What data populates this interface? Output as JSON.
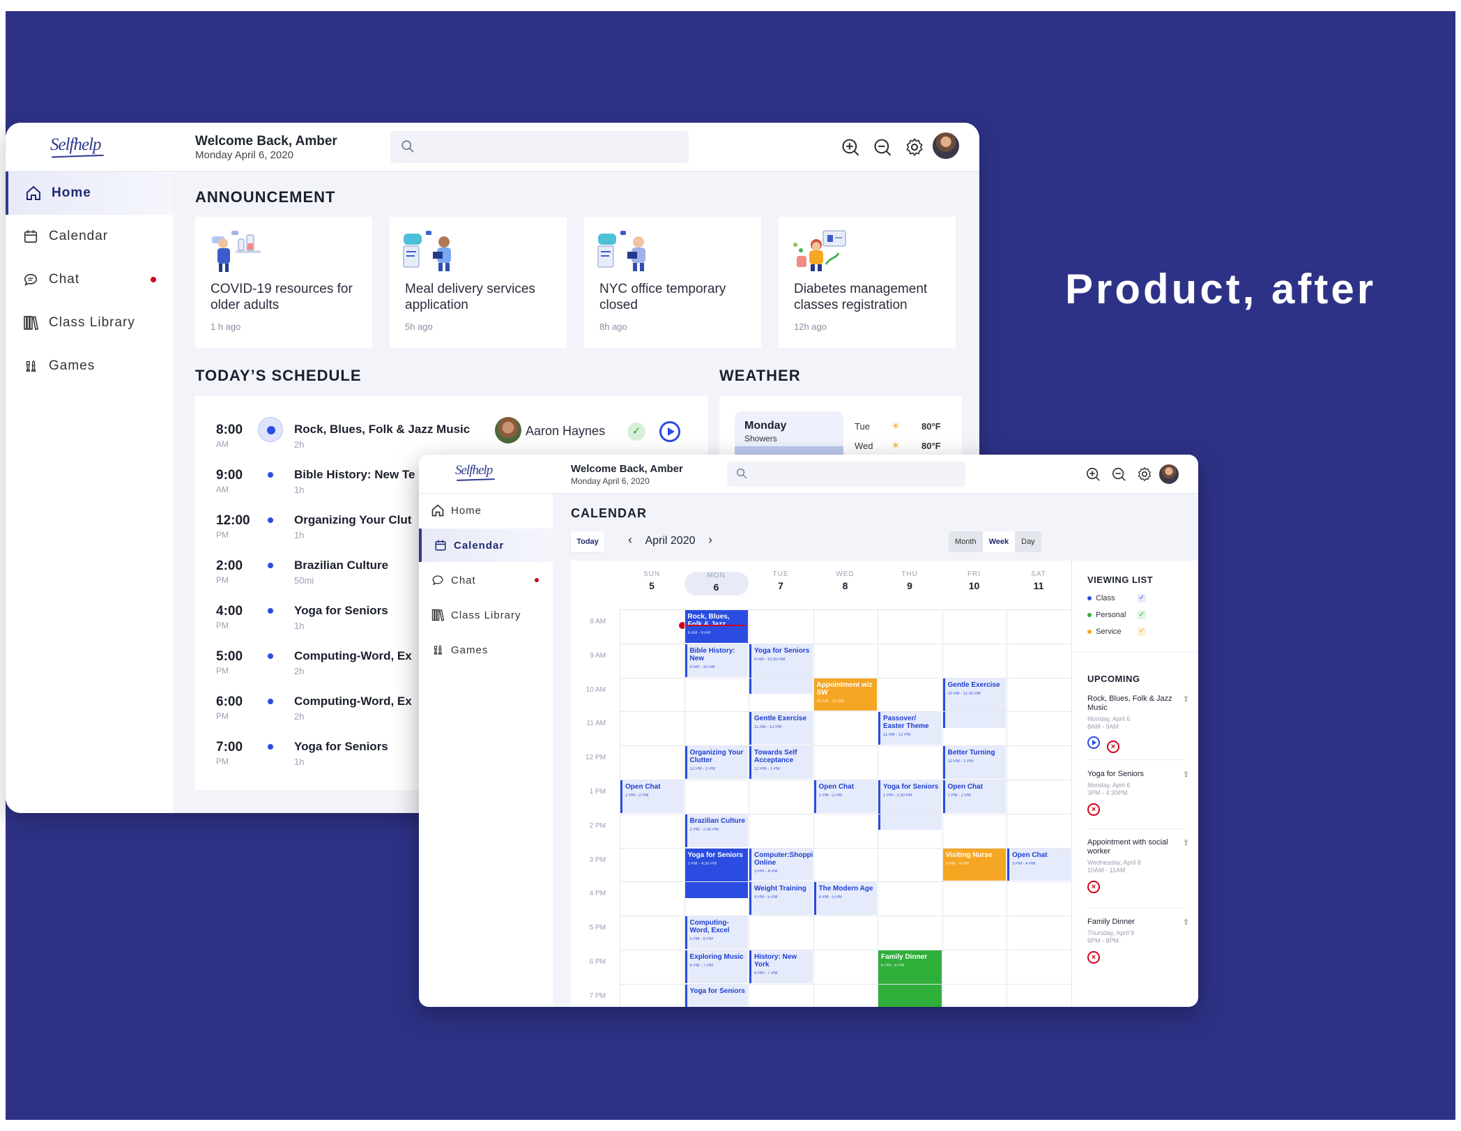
{
  "label": "Product, after",
  "colors": {
    "background": "#2e3287",
    "accent": "#2a4ce0",
    "class": "#2a4ce0",
    "personal": "#2fae3a",
    "service": "#f5a623",
    "alert": "#d0021b"
  },
  "home": {
    "logo": "Selfhelp",
    "welcome": "Welcome Back, Amber",
    "date": "Monday April 6, 2020",
    "toolbar_icons": [
      "zoom-in-icon",
      "zoom-out-icon",
      "gear-icon",
      "avatar"
    ],
    "nav": [
      {
        "label": "Home",
        "icon": "home-icon"
      },
      {
        "label": "Calendar",
        "icon": "calendar-icon"
      },
      {
        "label": "Chat",
        "icon": "chat-icon"
      },
      {
        "label": "Class Library",
        "icon": "library-icon"
      },
      {
        "label": "Games",
        "icon": "chess-icon"
      }
    ],
    "announcement_title": "ANNOUNCEMENT",
    "announcements": [
      {
        "title": "COVID-19 resources for older adults",
        "time": "1 h ago"
      },
      {
        "title": "Meal delivery services application",
        "time": "5h ago"
      },
      {
        "title": "NYC office temporary closed",
        "time": "8h ago"
      },
      {
        "title": "Diabetes management classes registration",
        "time": "12h ago"
      }
    ],
    "schedule_title": "TODAY’S SCHEDULE",
    "schedule": [
      {
        "time": "8:00",
        "ampm": "AM",
        "name": "Rock, Blues, Folk & Jazz Music",
        "dur": "2h",
        "teacher": "Aaron Haynes"
      },
      {
        "time": "9:00",
        "ampm": "AM",
        "name": "Bible History: New Te",
        "dur": "1h"
      },
      {
        "time": "12:00",
        "ampm": "PM",
        "name": "Organizing Your Clut",
        "dur": "1h"
      },
      {
        "time": "2:00",
        "ampm": "PM",
        "name": "Brazilian Culture",
        "dur": "50mi"
      },
      {
        "time": "4:00",
        "ampm": "PM",
        "name": "Yoga for Seniors",
        "dur": "1h"
      },
      {
        "time": "5:00",
        "ampm": "PM",
        "name": "Computing-Word, Ex",
        "dur": "2h"
      },
      {
        "time": "6:00",
        "ampm": "PM",
        "name": "Computing-Word, Ex",
        "dur": "2h"
      },
      {
        "time": "7:00",
        "ampm": "PM",
        "name": "Yoga for Seniors",
        "dur": "1h"
      }
    ],
    "weather_title": "WEATHER",
    "weather": {
      "today": {
        "day": "Monday",
        "cond": "Showers"
      },
      "forecast": [
        {
          "day": "Tue",
          "temp": "80°F",
          "icon": "sun-icon"
        },
        {
          "day": "Wed",
          "temp": "80°F",
          "icon": "sun-icon"
        }
      ]
    }
  },
  "calendar": {
    "logo": "Selfhelp",
    "welcome": "Welcome Back, Amber",
    "date": "Monday April 6, 2020",
    "nav": [
      {
        "label": "Home",
        "icon": "home-icon"
      },
      {
        "label": "Calendar",
        "icon": "calendar-icon"
      },
      {
        "label": "Chat",
        "icon": "chat-icon"
      },
      {
        "label": "Class Library",
        "icon": "library-icon"
      },
      {
        "label": "Games",
        "icon": "chess-icon"
      }
    ],
    "title": "CALENDAR",
    "today_button": "Today",
    "month": "April 2020",
    "views": [
      "Month",
      "Week",
      "Day"
    ],
    "selected_view": "Week",
    "days": [
      {
        "name": "SUN",
        "date": "5"
      },
      {
        "name": "MON",
        "date": "6"
      },
      {
        "name": "TUE",
        "date": "7"
      },
      {
        "name": "WED",
        "date": "8"
      },
      {
        "name": "THU",
        "date": "9"
      },
      {
        "name": "FRI",
        "date": "10"
      },
      {
        "name": "SAT",
        "date": "11"
      }
    ],
    "today_index": 1,
    "hours": [
      "8 AM",
      "9 AM",
      "10 AM",
      "11 AM",
      "12 PM",
      "1 PM",
      "2 PM",
      "3 PM",
      "4 PM",
      "5 PM",
      "6 PM",
      "7 PM"
    ],
    "events": [
      {
        "day": 1,
        "start": 8,
        "end": 9,
        "title": "Rock, Blues, Folk & Jazz",
        "time": "8 AM - 9 AM",
        "kind": "classF"
      },
      {
        "day": 1,
        "start": 9,
        "end": 10,
        "title": "Bible History: New",
        "time": "9 AM - 10 AM",
        "kind": "class"
      },
      {
        "day": 2,
        "start": 9,
        "end": 10.5,
        "title": "Yoga for Seniors",
        "time": "9 AM - 10:30 AM",
        "kind": "class"
      },
      {
        "day": 3,
        "start": 10,
        "end": 11,
        "title": "Appointment wiz SW",
        "time": "10 AM - 11 AM",
        "kind": "service"
      },
      {
        "day": 5,
        "start": 10,
        "end": 11.5,
        "title": "Gentle Exercise",
        "time": "10 AM - 11:30 AM",
        "kind": "class"
      },
      {
        "day": 2,
        "start": 11,
        "end": 12,
        "title": "Gentle Exercise",
        "time": "11 AM - 12 PM",
        "kind": "class"
      },
      {
        "day": 4,
        "start": 11,
        "end": 12,
        "title": "Passover/ Easter Theme",
        "time": "11 AM - 12 PM",
        "kind": "class"
      },
      {
        "day": 1,
        "start": 12,
        "end": 13,
        "title": "Organizing Your Clutter",
        "time": "12 PM - 1 PM",
        "kind": "class"
      },
      {
        "day": 2,
        "start": 12,
        "end": 13,
        "title": "Towards Self Acceptance",
        "time": "12 PM - 1 PM",
        "kind": "class"
      },
      {
        "day": 5,
        "start": 12,
        "end": 13,
        "title": "Better Turning",
        "time": "12 PM - 1 PM",
        "kind": "class"
      },
      {
        "day": 0,
        "start": 13,
        "end": 14,
        "title": "Open Chat",
        "time": "1 PM - 2 PM",
        "kind": "class"
      },
      {
        "day": 3,
        "start": 13,
        "end": 14,
        "title": "Open Chat",
        "time": "1 PM - 2 PM",
        "kind": "class"
      },
      {
        "day": 4,
        "start": 13,
        "end": 14.5,
        "title": "Yoga for Seniors",
        "time": "1 PM - 1:30 PM",
        "kind": "class"
      },
      {
        "day": 5,
        "start": 13,
        "end": 14,
        "title": "Open Chat",
        "time": "1 PM - 2 PM",
        "kind": "class"
      },
      {
        "day": 1,
        "start": 14,
        "end": 15,
        "title": "Brazilian Culture",
        "time": "2 PM - 2:50 PM",
        "kind": "class"
      },
      {
        "day": 1,
        "start": 15,
        "end": 16.5,
        "title": "Yoga for Seniors",
        "time": "3 PM - 4:30 PM",
        "kind": "classF"
      },
      {
        "day": 2,
        "start": 15,
        "end": 16,
        "title": "Computer:Shopping Online",
        "time": "3 PM - 4 PM",
        "kind": "class"
      },
      {
        "day": 5,
        "start": 15,
        "end": 16,
        "title": "Visiting Nurse",
        "time": "3 PM - 4 PM",
        "kind": "service"
      },
      {
        "day": 6,
        "start": 15,
        "end": 16,
        "title": "Open Chat",
        "time": "3 PM - 4 PM",
        "kind": "class"
      },
      {
        "day": 2,
        "start": 16,
        "end": 17,
        "title": "Weight Training",
        "time": "4 PM - 5 PM",
        "kind": "class"
      },
      {
        "day": 3,
        "start": 16,
        "end": 17,
        "title": "The Modern Age",
        "time": "4 PM - 5 PM",
        "kind": "class"
      },
      {
        "day": 1,
        "start": 17,
        "end": 18,
        "title": "Computing-Word, Excel",
        "time": "5 PM - 6 PM",
        "kind": "class"
      },
      {
        "day": 1,
        "start": 18,
        "end": 19,
        "title": "Exploring Music",
        "time": "6 PM - 7 PM",
        "kind": "class"
      },
      {
        "day": 2,
        "start": 18,
        "end": 19,
        "title": "History: New York",
        "time": "6 PM - 7 PM",
        "kind": "class"
      },
      {
        "day": 4,
        "start": 18,
        "end": 20,
        "title": "Family Dinner",
        "time": "6 PM - 8 PM",
        "kind": "personal"
      },
      {
        "day": 1,
        "start": 19,
        "end": 20,
        "title": "Yoga for Seniors",
        "time": "",
        "kind": "class"
      }
    ],
    "viewing_list_title": "VIEWING LIST",
    "viewing_list": [
      {
        "label": "Class",
        "color": "#2a4ce0"
      },
      {
        "label": "Personal",
        "color": "#2fae3a"
      },
      {
        "label": "Service",
        "color": "#f5a623"
      }
    ],
    "upcoming_title": "UPCOMING",
    "upcoming": [
      {
        "name": "Rock, Blues, Folk & Jazz Music",
        "date": "Monday, April 6",
        "time": "8AM - 9AM",
        "play": true
      },
      {
        "name": "Yoga for Seniors",
        "date": "Monday, April 6",
        "time": "3PM - 4:30PM",
        "play": false
      },
      {
        "name": "Appointment with social worker",
        "date": "Wednesday, April 8",
        "time": "10AM - 11AM",
        "play": false
      },
      {
        "name": "Family Dinner",
        "date": "Thursday, April 9",
        "time": "6PM - 8PM",
        "play": false
      }
    ]
  }
}
